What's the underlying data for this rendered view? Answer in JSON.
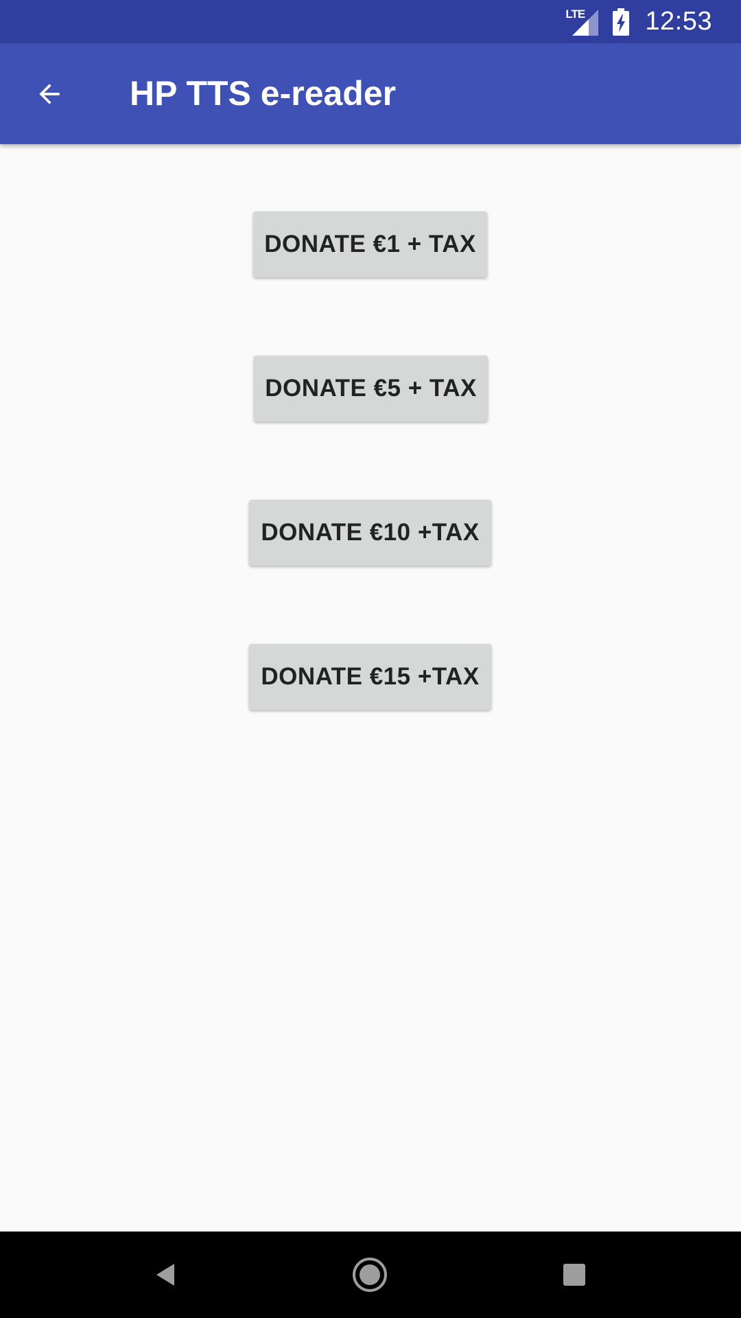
{
  "status_bar": {
    "network_label": "LTE",
    "time": "12:53",
    "icons": [
      "lte-signal-icon",
      "battery-charging-icon"
    ],
    "background_color": "#303f9f"
  },
  "app_bar": {
    "title": "HP TTS e-reader",
    "back_icon": "arrow-back-icon",
    "background_color": "#3f51b5"
  },
  "donate_buttons": [
    {
      "label": "DONATE €1 + TAX"
    },
    {
      "label": "DONATE €5 + TAX"
    },
    {
      "label": "DONATE €10 +TAX"
    },
    {
      "label": "DONATE €15 +TAX"
    }
  ],
  "nav_bar": {
    "icons": [
      "back-triangle-icon",
      "home-circle-icon",
      "recents-square-icon"
    ]
  }
}
